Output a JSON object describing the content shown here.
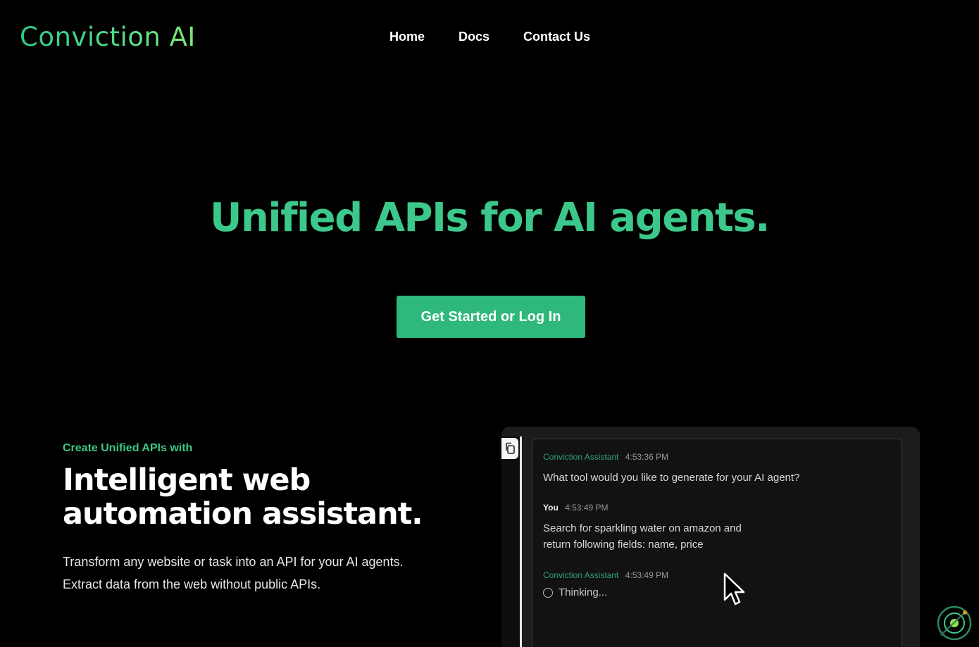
{
  "brand": {
    "logo_text": "Conviction AI"
  },
  "nav": {
    "items": [
      "Home",
      "Docs",
      "Contact Us"
    ]
  },
  "hero": {
    "title": "Unified APIs for AI agents.",
    "cta_label": "Get Started or Log In"
  },
  "feature": {
    "eyebrow": "Create Unified APIs with",
    "title_line1": "Intelligent web",
    "title_line2": "automation assistant.",
    "desc_line1": "Transform any website or task into an API for your AI agents.",
    "desc_line2": "Extract data from the web without public APIs."
  },
  "chat": {
    "messages": [
      {
        "author": "Conviction Assistant",
        "time": "4:53:36 PM",
        "text": "What tool would you like to generate for your AI agent?"
      },
      {
        "author": "You",
        "time": "4:53:49 PM",
        "text_line1": "Search for sparkling water on amazon and",
        "text_line2": "return following fields: name, price"
      },
      {
        "author": "Conviction Assistant",
        "time": "4:53:49 PM",
        "status": "Thinking..."
      }
    ]
  },
  "colors": {
    "accent": "#3cc88a",
    "button": "#2fb87c",
    "background": "#000000"
  },
  "icons": {
    "side_tab": "copy-icon",
    "pointer": "mouse-cursor-icon",
    "floating_widget": "orbit-widget-icon",
    "thinking": "loading-circle-icon"
  }
}
